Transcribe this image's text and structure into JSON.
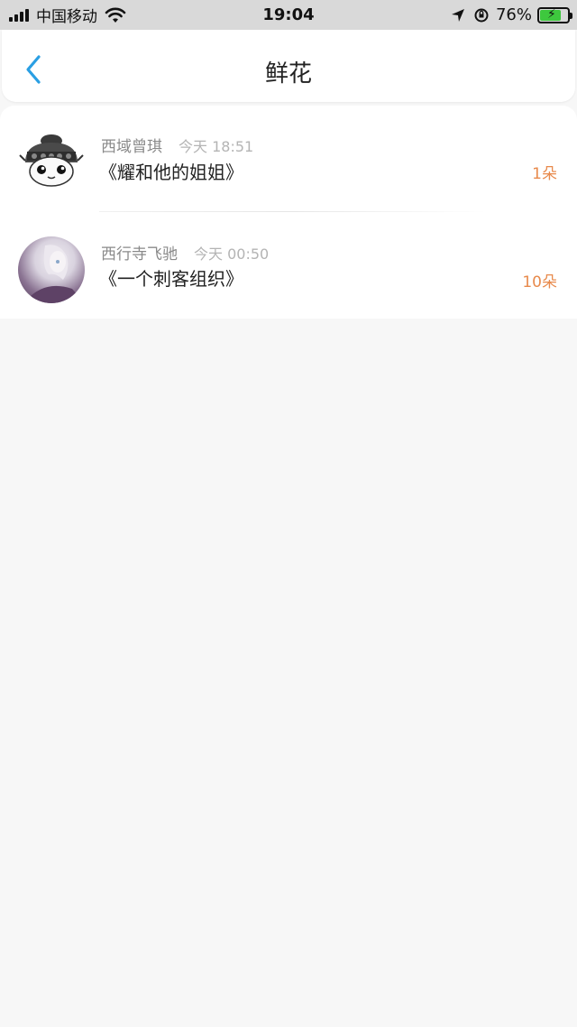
{
  "status_bar": {
    "carrier": "中国移动",
    "time": "19:04",
    "battery_percent": "76%",
    "battery_level": 0.76,
    "icons": [
      "signal-icon",
      "wifi-icon",
      "location-icon",
      "rotation-lock-icon",
      "battery-charging-icon"
    ]
  },
  "nav": {
    "title": "鲜花",
    "back_icon": "chevron-left-icon",
    "accent": "#2a9fe3"
  },
  "items": [
    {
      "user": "西域曾琪",
      "time": "今天 18:51",
      "book": "《耀和他的姐姐》",
      "count": "1朵"
    },
    {
      "user": "西行寺飞驰",
      "time": "今天 00:50",
      "book": "《一个刺客组织》",
      "count": "10朵"
    }
  ],
  "colors": {
    "count": "#e88a4c",
    "background": "#f7f7f7"
  }
}
